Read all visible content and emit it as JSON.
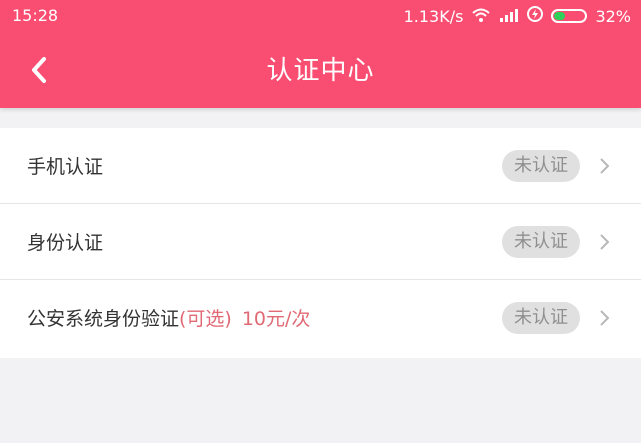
{
  "status_bar": {
    "time": "15:28",
    "speed": "1.13K/s",
    "battery_percent": "32%",
    "battery_level": 0.32
  },
  "header": {
    "title": "认证中心",
    "bg_color": "#f94e72"
  },
  "rows": [
    {
      "label": "手机认证",
      "status": "未认证"
    },
    {
      "label": "身份认证",
      "status": "未认证"
    },
    {
      "label": "公安系统身份验证",
      "optional": "(可选)",
      "price": "10元/次",
      "status": "未认证"
    }
  ]
}
